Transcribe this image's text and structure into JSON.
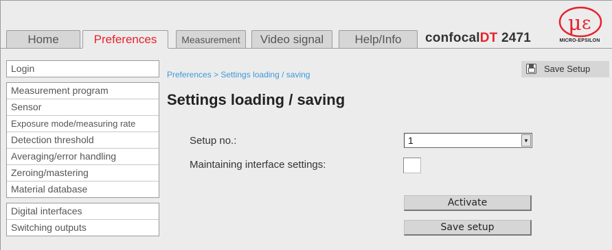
{
  "tabs": [
    {
      "label": "Home",
      "active": false
    },
    {
      "label": "Preferences",
      "active": true
    },
    {
      "label": "Measurement",
      "active": false
    },
    {
      "label": "Video signal",
      "active": false
    },
    {
      "label": "Help/Info",
      "active": false
    }
  ],
  "brand": {
    "prefix": "confocal",
    "highlight": "DT",
    "model": " 2471"
  },
  "logo": {
    "text": "MICRO-EPSILON"
  },
  "sidebar": {
    "groups": [
      [
        "Login"
      ],
      [
        "Measurement program",
        "Sensor",
        "Exposure mode/measuring rate",
        "Detection threshold",
        "Averaging/error handling",
        "Zeroing/mastering",
        "Material database"
      ],
      [
        "Digital interfaces",
        "Switching outputs"
      ]
    ]
  },
  "breadcrumb": "Preferences > Settings loading / saving",
  "toolbar": {
    "save_label": "Save Setup"
  },
  "page_title": "Settings loading / saving",
  "form": {
    "setup_label": "Setup no.:",
    "setup_value": "1",
    "maintain_label": "Maintaining interface settings:",
    "maintain_checked": false,
    "activate_label": "Activate",
    "save_label": "Save setup"
  },
  "colors": {
    "accent_red": "#e8212b",
    "link_blue": "#3a9ad9",
    "background": "#ececec"
  }
}
